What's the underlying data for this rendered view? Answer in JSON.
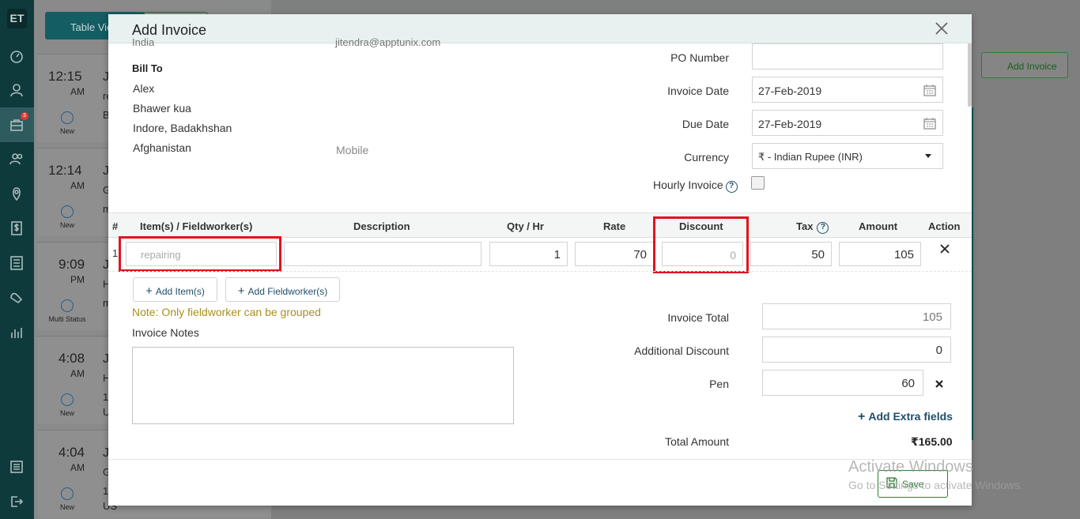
{
  "sidebar": {
    "logo": "ET",
    "badge_count": "3",
    "items": [
      "dashboard-icon",
      "user-icon",
      "briefcase-icon",
      "users-icon",
      "map-pin-icon",
      "dollar-icon",
      "list-icon",
      "tag-icon",
      "chart-icon",
      "sliders-icon",
      "logout-icon"
    ]
  },
  "list": {
    "table_view_label": "Table Vie",
    "cards": [
      {
        "time": "12:15",
        "ampm": "AM",
        "status": "New",
        "l1": "Ji",
        "l2": "re",
        "l3": "B"
      },
      {
        "time": "12:14",
        "ampm": "AM",
        "status": "New",
        "l1": "Ji",
        "l2": "G",
        "l3": "m"
      },
      {
        "time": "9:09",
        "ampm": "PM",
        "status": "Multi Status",
        "l1": "Ji",
        "l2": "H",
        "l3": "m"
      },
      {
        "time": "4:08",
        "ampm": "AM",
        "status": "New",
        "l1": "Ji",
        "l2": "H",
        "l3": "1",
        "l4": "U"
      },
      {
        "time": "4:04",
        "ampm": "AM",
        "status": "New",
        "l1": "Ji",
        "l2": "G",
        "l3": "1",
        "l4": "US"
      }
    ]
  },
  "bg": {
    "add_invoice_label": "Add Invoice"
  },
  "modal": {
    "title": "Add Invoice",
    "partial_left": "India",
    "partial_email": "jitendra@apptunix.com",
    "bill_to_label": "Bill To",
    "bill_to": [
      "Alex",
      "Bhawer kua",
      "Indore, Badakhshan",
      "Afghanistan"
    ],
    "mobile_label": "Mobile",
    "fields": {
      "po_label": "PO Number",
      "po_value": "",
      "invoice_date_label": "Invoice Date",
      "invoice_date_value": "27-Feb-2019",
      "due_date_label": "Due Date",
      "due_date_value": "27-Feb-2019",
      "currency_label": "Currency",
      "currency_value": "₹ - Indian Rupee (INR)",
      "hourly_label": "Hourly Invoice"
    },
    "table": {
      "headers": {
        "num": "#",
        "item": "Item(s) / Fieldworker(s)",
        "desc": "Description",
        "qty": "Qty / Hr",
        "rate": "Rate",
        "discount": "Discount",
        "tax": "Tax",
        "amount": "Amount",
        "action": "Action"
      },
      "row": {
        "num": "1",
        "item_placeholder": "repairing",
        "description": "",
        "qty": "1",
        "rate": "70",
        "discount_placeholder": "0",
        "tax": "50",
        "amount": "105"
      }
    },
    "add_item_label": "Add Item(s)",
    "add_fieldworker_label": "Add Fieldworker(s)",
    "note": "Note: Only fieldworker can be grouped",
    "notes_label": "Invoice Notes",
    "totals": {
      "invoice_total_label": "Invoice Total",
      "invoice_total": "105",
      "additional_discount_label": "Additional Discount",
      "additional_discount": "0",
      "pen_label": "Pen",
      "pen_value": "60",
      "extra_fields_label": "Add Extra fields",
      "total_amount_label": "Total Amount",
      "total_amount": "₹165.00"
    },
    "save_label": "Save"
  },
  "watermark": {
    "line1": "Activate Windows",
    "line2": "Go to Settings to activate Windows."
  }
}
